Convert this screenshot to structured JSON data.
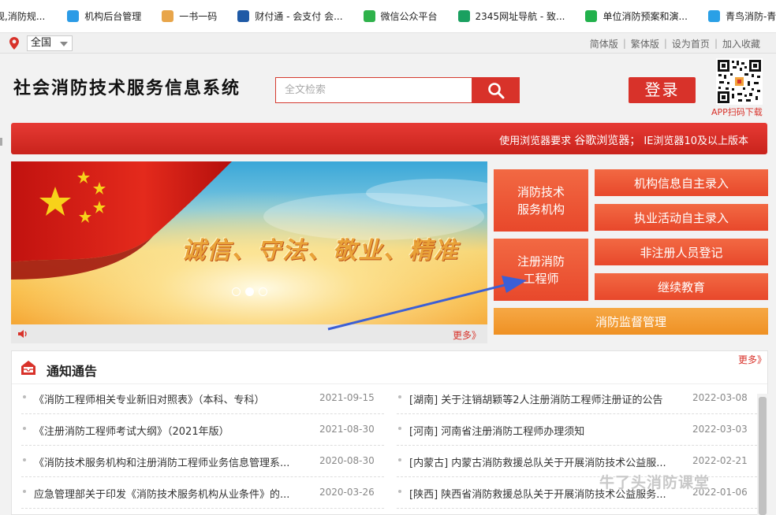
{
  "bookmarks": [
    {
      "label": "规,消防规...",
      "icon": "doc-icon",
      "color": "#ffffff"
    },
    {
      "label": "机构后台管理",
      "icon": "diamond-icon",
      "color": "#2b9be6"
    },
    {
      "label": "一书一码",
      "icon": "book-icon",
      "color": "#e8a54a"
    },
    {
      "label": "财付通 - 会支付 会...",
      "icon": "shield-icon",
      "color": "#1f5aa6"
    },
    {
      "label": "微信公众平台",
      "icon": "wechat-ring-icon",
      "color": "#2fb24b"
    },
    {
      "label": "2345网址导航 - 致...",
      "icon": "globe-icon",
      "color": "#1aa060"
    },
    {
      "label": "单位消防预案和演...",
      "icon": "wechat-icon",
      "color": "#22b14c"
    },
    {
      "label": "青鸟消防-青鸟消防...",
      "icon": "bird-icon",
      "color": "#2aa0e6"
    }
  ],
  "topbar": {
    "region": "全国",
    "links": [
      "简体版",
      "繁体版",
      "设为首页",
      "加入收藏"
    ]
  },
  "header": {
    "site_title": "社会消防技术服务信息系统",
    "search_placeholder": "全文检索",
    "login_label": "登录",
    "qr_label": "APP扫码下载"
  },
  "notice_banner": {
    "prefix": "使用浏览器要求",
    "browser": "谷歌浏览器；",
    "suffix": "IE浏览器10及以上版本"
  },
  "slider": {
    "slogan": "诚信、守法、敬业、精准",
    "dot_count": 3,
    "active_dot": 1,
    "more_label": "更多》"
  },
  "tiles": {
    "tech_service_org": "消防技术\n服务机构",
    "registered_engineer": "注册消防\n工程师",
    "org_info_entry": "机构信息自主录入",
    "practice_entry": "执业活动自主录入",
    "unregistered_staff": "非注册人员登记",
    "continuing_edu": "继续教育",
    "fire_supervision": "消防监督管理"
  },
  "notices": {
    "title": "通知通告",
    "more_label": "更多》",
    "left": [
      {
        "title": "《消防工程师相关专业新旧对照表》（本科、专科）",
        "date": "2021-09-15"
      },
      {
        "title": "《注册消防工程师考试大纲》（2021年版）",
        "date": "2021-08-30"
      },
      {
        "title": "《消防技术服务机构和注册消防工程师业务信息管理系...",
        "date": "2020-08-30"
      },
      {
        "title": "应急管理部关于印发《消防技术服务机构从业条件》的...",
        "date": "2020-03-26"
      }
    ],
    "right": [
      {
        "title": "[湖南] 关于注销胡颖等2人注册消防工程师注册证的公告",
        "date": "2022-03-08"
      },
      {
        "title": "[河南] 河南省注册消防工程师办理须知",
        "date": "2022-03-03"
      },
      {
        "title": "[内蒙古] 内蒙古消防救援总队关于开展消防技术公益服...",
        "date": "2022-02-21"
      },
      {
        "title": "[陕西] 陕西省消防救援总队关于开展消防技术公益服务...",
        "date": "2022-01-06"
      }
    ]
  },
  "watermark": "牛了头消防课堂",
  "colors": {
    "brand_red": "#d8322a",
    "tile_orange": "#ef5a35",
    "tile_amber": "#f2a33a"
  }
}
